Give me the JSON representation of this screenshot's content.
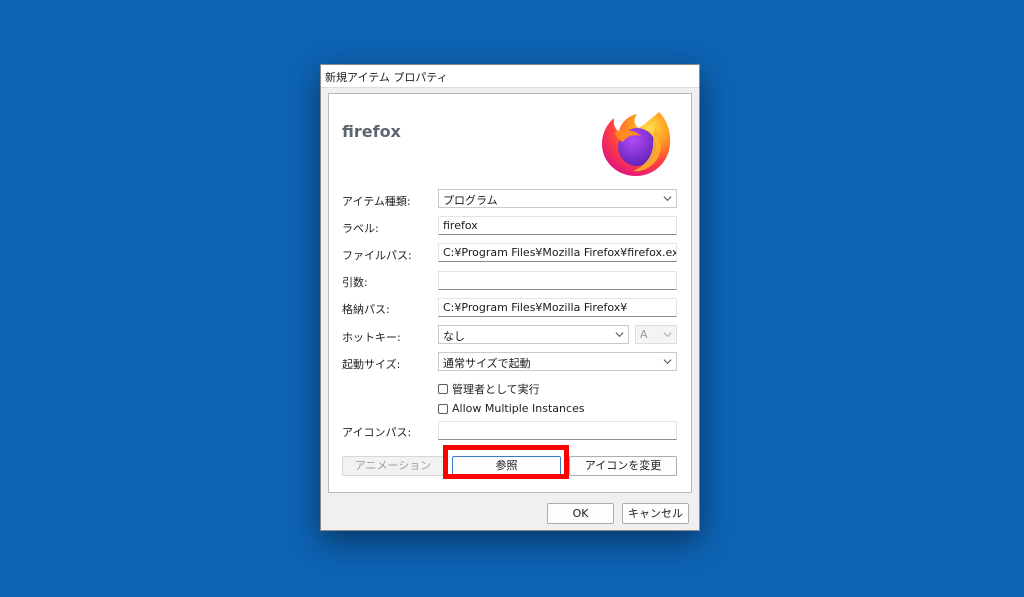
{
  "window": {
    "title": "新規アイテム プロパティ"
  },
  "header": {
    "app_name": "firefox",
    "icon": "firefox-logo-icon"
  },
  "form": {
    "item_type": {
      "label": "アイテム種類:",
      "value": "プログラム"
    },
    "label": {
      "label": "ラベル:",
      "value": "firefox"
    },
    "file_path": {
      "label": "ファイルパス:",
      "value": "C:¥Program Files¥Mozilla Firefox¥firefox.exe"
    },
    "arguments": {
      "label": "引数:",
      "value": ""
    },
    "working_dir": {
      "label": "格納パス:",
      "value": "C:¥Program Files¥Mozilla Firefox¥"
    },
    "hotkey": {
      "label": "ホットキー:",
      "value": "なし",
      "key_value": "A"
    },
    "launch_size": {
      "label": "起動サイズ:",
      "value": "通常サイズで起動"
    },
    "run_as_admin": {
      "label": "管理者として実行",
      "checked": false
    },
    "multiple_instances": {
      "label": "Allow Multiple Instances",
      "checked": false
    },
    "icon_path": {
      "label": "アイコンパス:",
      "value": ""
    }
  },
  "buttons": {
    "animation": "アニメーション",
    "browse": "参照",
    "change_icon": "アイコンを変更",
    "ok": "OK",
    "cancel": "キャンセル"
  },
  "colors": {
    "desktop": "#0d63b4",
    "highlight": "#ff0000"
  }
}
